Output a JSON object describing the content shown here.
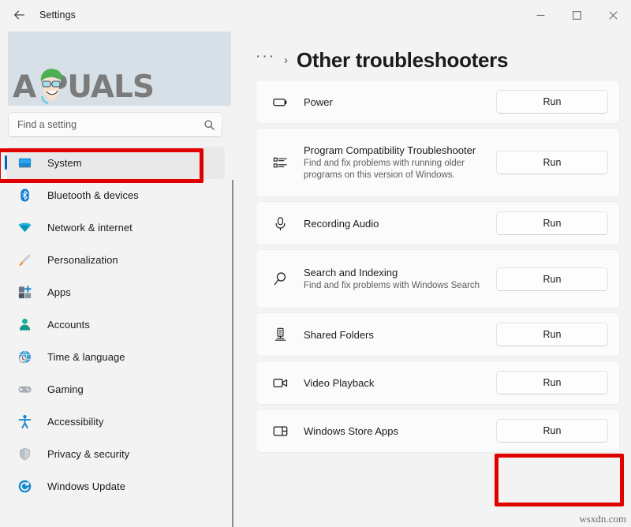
{
  "titlebar": {
    "back_label": "back-arrow",
    "title": "Settings",
    "minimize": "—",
    "maximize": "□",
    "close": "✕"
  },
  "sidebar": {
    "watermark_text": "A PUALS",
    "watermark_prefix": "A",
    "watermark_suffix": "PUALS",
    "search": {
      "placeholder": "Find a setting",
      "value": "",
      "icon": "search-icon"
    },
    "items": [
      {
        "label": "System",
        "icon": "monitor-icon",
        "selected": true
      },
      {
        "label": "Bluetooth & devices",
        "icon": "bluetooth-icon",
        "selected": false
      },
      {
        "label": "Network & internet",
        "icon": "wifi-icon",
        "selected": false
      },
      {
        "label": "Personalization",
        "icon": "paintbrush-icon",
        "selected": false
      },
      {
        "label": "Apps",
        "icon": "apps-grid-icon",
        "selected": false
      },
      {
        "label": "Accounts",
        "icon": "person-icon",
        "selected": false
      },
      {
        "label": "Time & language",
        "icon": "clock-globe-icon",
        "selected": false
      },
      {
        "label": "Gaming",
        "icon": "gamepad-icon",
        "selected": false
      },
      {
        "label": "Accessibility",
        "icon": "accessibility-person-icon",
        "selected": false
      },
      {
        "label": "Privacy & security",
        "icon": "shield-icon",
        "selected": false
      },
      {
        "label": "Windows Update",
        "icon": "update-refresh-icon",
        "selected": false
      }
    ]
  },
  "main": {
    "breadcrumb": {
      "overflow": "···",
      "separator": "›",
      "title": "Other troubleshooters"
    },
    "run_label": "Run",
    "troubleshooters": [
      {
        "name": "Power",
        "description": "",
        "icon": "battery-icon",
        "button": "Run",
        "size": "normal",
        "highlighted": false
      },
      {
        "name": "Program Compatibility Troubleshooter",
        "description": "Find and fix problems with running older programs on this version of Windows.",
        "icon": "list-bullets-icon",
        "button": "Run",
        "size": "xtall",
        "highlighted": false
      },
      {
        "name": "Recording Audio",
        "description": "",
        "icon": "microphone-icon",
        "button": "Run",
        "size": "normal",
        "highlighted": false
      },
      {
        "name": "Search and Indexing",
        "description": "Find and fix problems with Windows Search",
        "icon": "magnifier-icon",
        "button": "Run",
        "size": "tall",
        "highlighted": false
      },
      {
        "name": "Shared Folders",
        "description": "",
        "icon": "server-share-icon",
        "button": "Run",
        "size": "normal",
        "highlighted": false
      },
      {
        "name": "Video Playback",
        "description": "",
        "icon": "video-camera-icon",
        "button": "Run",
        "size": "normal",
        "highlighted": false
      },
      {
        "name": "Windows Store Apps",
        "description": "",
        "icon": "store-panel-icon",
        "button": "Run",
        "size": "normal",
        "highlighted": true
      }
    ]
  },
  "annotations": {
    "highlight_color": "#e00000",
    "boxes": [
      {
        "name": "system-nav-highlight"
      },
      {
        "name": "windows-store-apps-run-highlight"
      }
    ]
  },
  "site_watermark": "wsxdn.com"
}
